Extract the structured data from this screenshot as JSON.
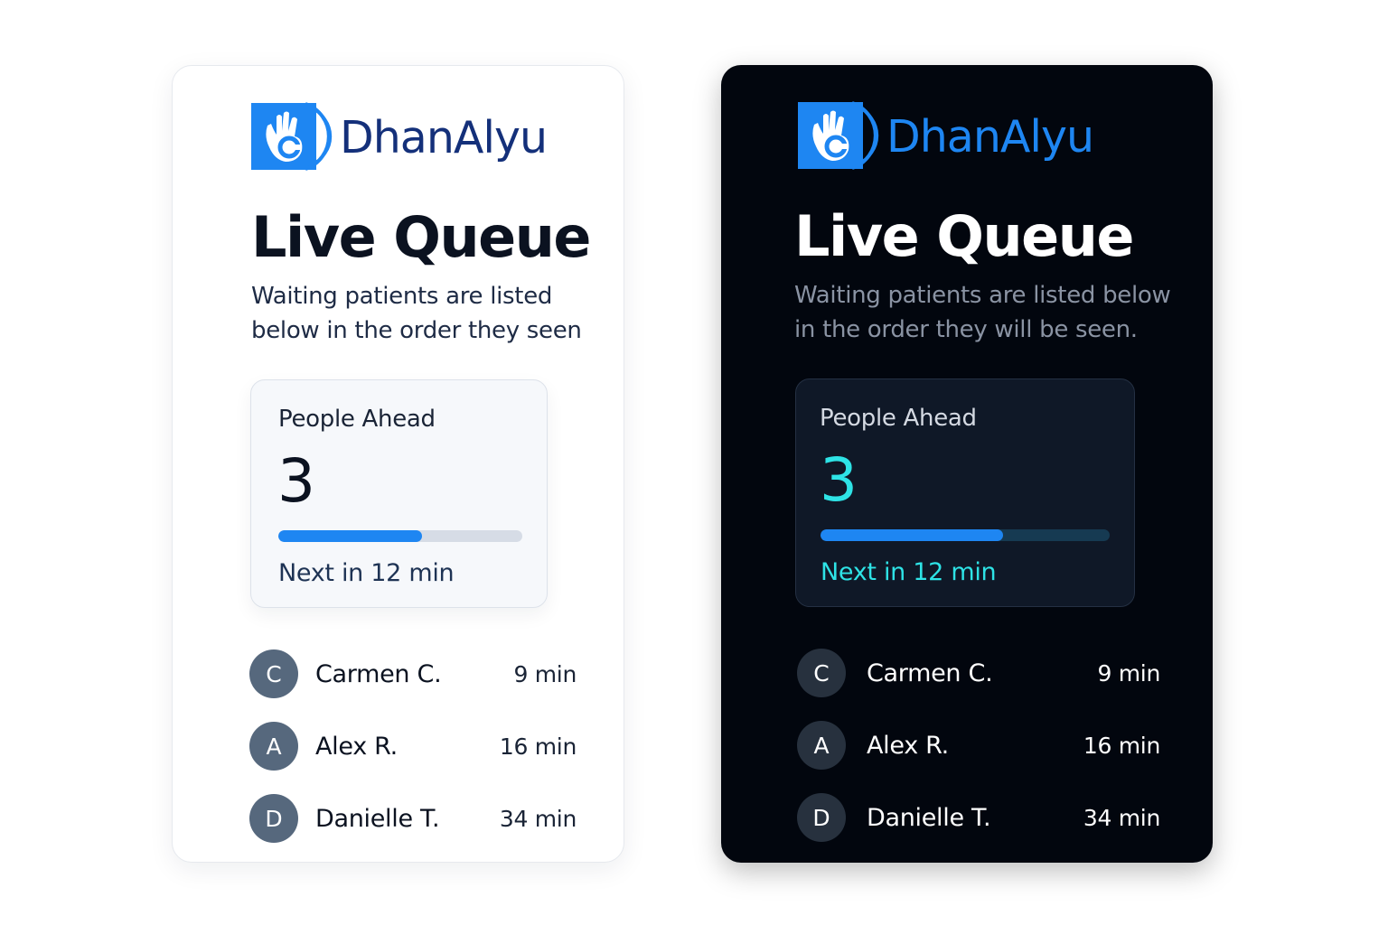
{
  "brand": {
    "name": "DhanAlyu",
    "logo_icon": "hand-ok-c-logo",
    "colors": {
      "logo_blue": "#1e86f2",
      "name_light": "#14307a",
      "name_dark": "#1e86f2"
    }
  },
  "cards": {
    "light": {
      "theme": "light",
      "title": "Live Queue",
      "subtitle_line1": "Waiting patients are listed",
      "subtitle_line2": "below in the order they seen",
      "people_ahead": {
        "label": "People Ahead",
        "value": "3",
        "progress_percent": 59,
        "next_text": "Next in 12 min"
      },
      "queue": [
        {
          "initial": "C",
          "name": "Carmen C.",
          "eta": "9 min"
        },
        {
          "initial": "A",
          "name": "Alex R.",
          "eta": "16 min"
        },
        {
          "initial": "D",
          "name": "Danielle T.",
          "eta": "34 min"
        }
      ]
    },
    "dark": {
      "theme": "dark",
      "title": "Live Queue",
      "subtitle_line1": "Waiting patients are listed below",
      "subtitle_line2": "in the order they will be seen.",
      "people_ahead": {
        "label": "People Ahead",
        "value": "3",
        "progress_percent": 63,
        "next_text": "Next in 12 min"
      },
      "queue": [
        {
          "initial": "C",
          "name": "Carmen C.",
          "eta": "9 min"
        },
        {
          "initial": "A",
          "name": "Alex R.",
          "eta": "16 min"
        },
        {
          "initial": "D",
          "name": "Danielle T.",
          "eta": "34 min"
        }
      ]
    }
  },
  "colors": {
    "accent": "#1e86f2",
    "teal_accent": "#2ee3e6",
    "dark_background": "#02060e"
  }
}
